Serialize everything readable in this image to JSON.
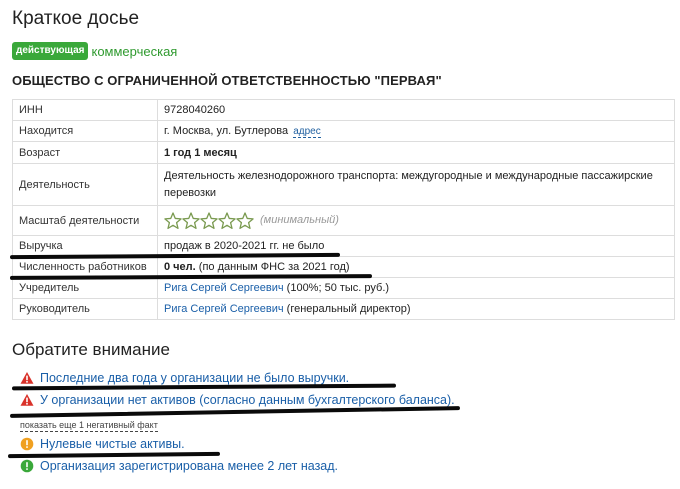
{
  "page": {
    "title": "Краткое досье"
  },
  "status": {
    "active_badge": "действующая",
    "type": "коммерческая"
  },
  "org": {
    "name": "ОБЩЕСТВО С ОГРАНИЧЕННОЙ ОТВЕТСТВЕННОСТЬЮ \"ПЕРВАЯ\""
  },
  "table": {
    "inn": {
      "label": "ИНН",
      "value": "9728040260"
    },
    "location": {
      "label": "Находится",
      "value": "г. Москва, ул. Бутлерова",
      "link": "адрес"
    },
    "age": {
      "label": "Возраст",
      "value": "1 год 1 месяц"
    },
    "activity": {
      "label": "Деятельность",
      "value": "Деятельность железнодорожного транспорта: междугородные и международные пассажирские перевозки"
    },
    "scale": {
      "label": "Масштаб деятельности",
      "stars_filled": 0,
      "stars_total": 5,
      "note": "(минимальный)"
    },
    "revenue": {
      "label": "Выручка",
      "value": "продаж в 2020-2021 гг. не было"
    },
    "employees": {
      "label": "Численность работников",
      "value_bold": "0 чел.",
      "value_rest": " (по данным ФНС за 2021 год)"
    },
    "founder": {
      "label": "Учредитель",
      "name": "Рига Сергей Сергеевич",
      "detail": " (100%; 50 тыс. руб.)"
    },
    "director": {
      "label": "Руководитель",
      "name": "Рига Сергей Сергеевич",
      "detail": " (генеральный директор)"
    }
  },
  "attention": {
    "title": "Обратите внимание",
    "alerts": [
      {
        "level": "danger",
        "icon": "warning-triangle-icon",
        "text": "Последние два года у организации не было выручки."
      },
      {
        "level": "danger",
        "icon": "warning-triangle-icon",
        "text": "У организации нет активов (согласно данным бухгалтерского баланса)."
      },
      {
        "level": "caution",
        "icon": "exclamation-circle-icon",
        "text": "Нулевые чистые активы."
      },
      {
        "level": "info",
        "icon": "exclamation-circle-icon",
        "text": "Организация зарегистрирована менее 2 лет назад."
      }
    ],
    "show_more": "показать еще 1 негативный факт"
  },
  "colors": {
    "danger": "#d9322a",
    "caution": "#f0a020",
    "link": "#1a5fa8",
    "active_badge": "#3aa83a",
    "star": "#7a9a50"
  }
}
